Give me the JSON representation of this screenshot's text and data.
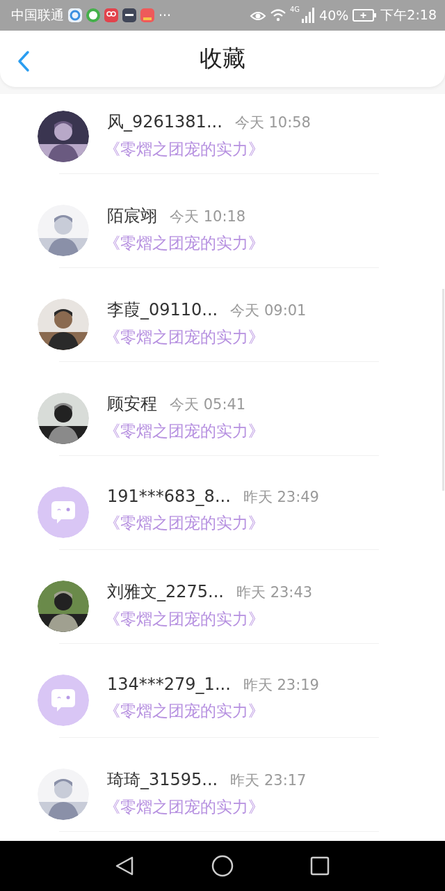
{
  "status_bar": {
    "carrier": "中国联通",
    "more": "···",
    "network": "4G",
    "battery": "40%",
    "time": "下午2:18"
  },
  "header": {
    "title": "收藏"
  },
  "favorites": [
    {
      "name": "风_9261381...",
      "time": "今天 10:58",
      "title": "《零熠之团宠的实力》"
    },
    {
      "name": "陌宸翊",
      "time": "今天 10:18",
      "title": "《零熠之团宠的实力》"
    },
    {
      "name": "李葭_09110...",
      "time": "今天 09:01",
      "title": "《零熠之团宠的实力》"
    },
    {
      "name": "顾安程",
      "time": "今天 05:41",
      "title": "《零熠之团宠的实力》"
    },
    {
      "name": "191***683_8...",
      "time": "昨天 23:49",
      "title": "《零熠之团宠的实力》",
      "avatar": {
        "kind": "default"
      }
    },
    {
      "name": "刘雅文_2275...",
      "time": "昨天 23:43",
      "title": "《零熠之团宠的实力》"
    },
    {
      "name": "134***279_1...",
      "time": "昨天 23:19",
      "title": "《零熠之团宠的实力》",
      "avatar": {
        "kind": "default"
      }
    },
    {
      "name": "琦琦_31595...",
      "time": "昨天 23:17",
      "title": "《零熠之团宠的实力》"
    }
  ]
}
